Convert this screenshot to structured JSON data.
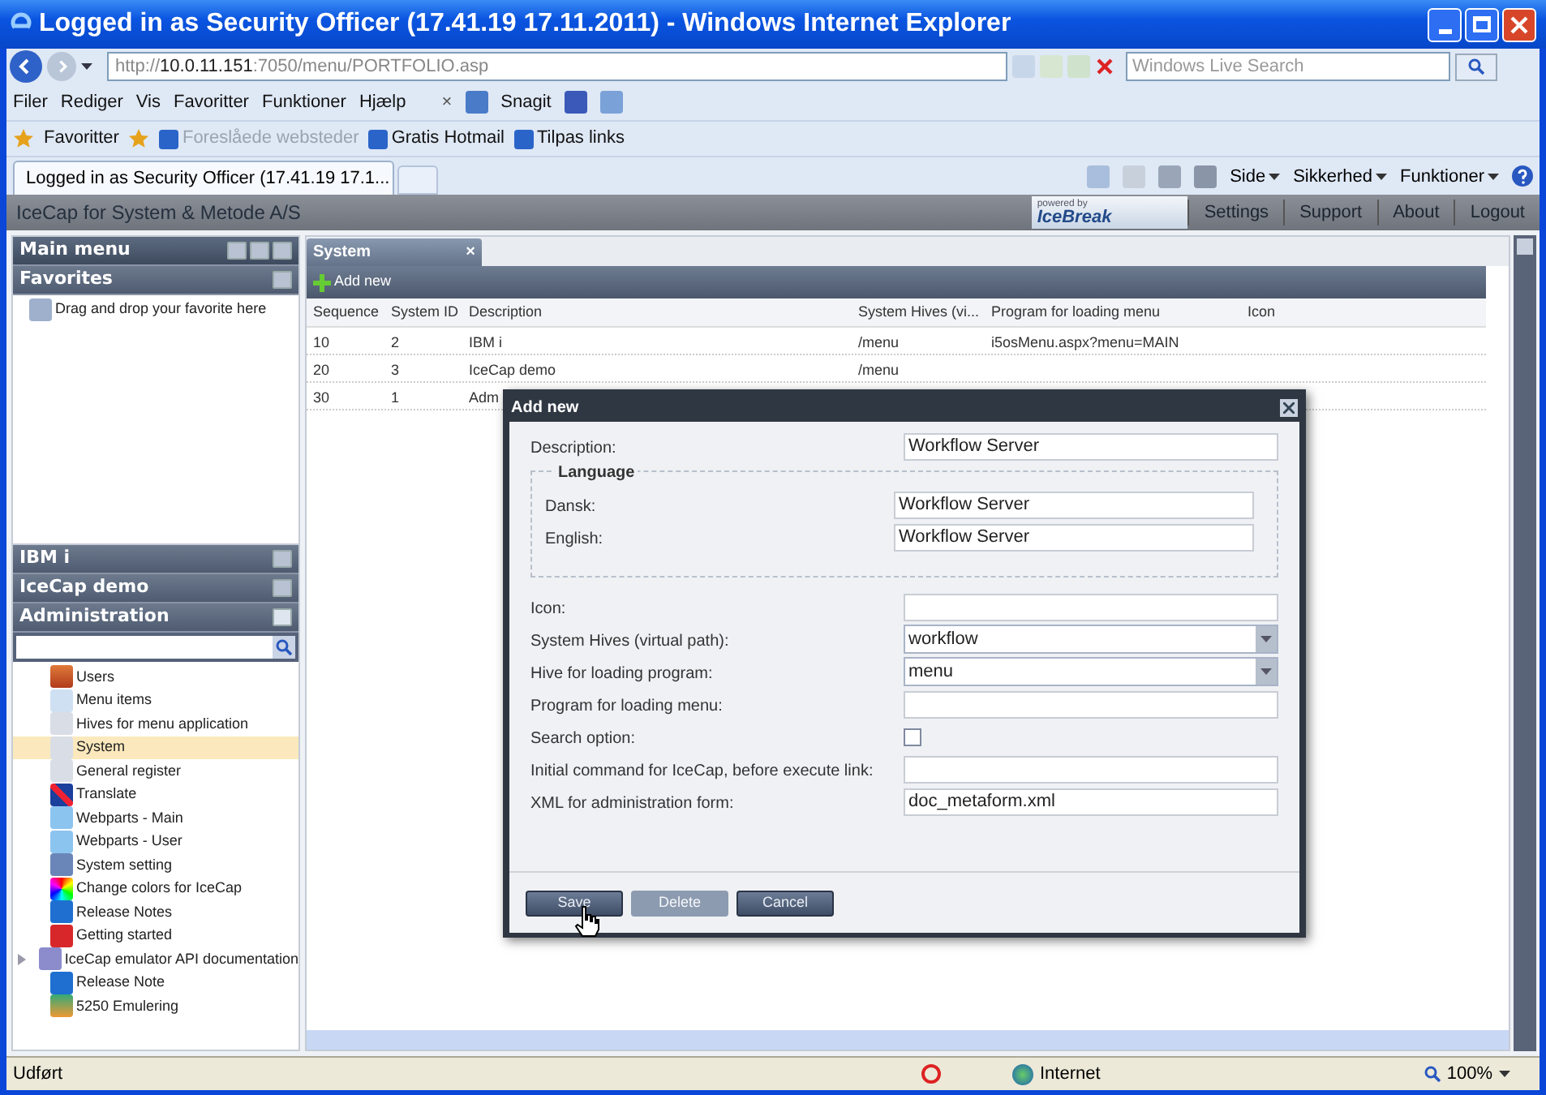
{
  "window": {
    "title": "Logged in as Security Officer (17.41.19 17.11.2011) - Windows Internet Explorer"
  },
  "address_bar": {
    "url_prefix": "http://",
    "url_host": "10.0.11.151",
    "url_rest": ":7050/menu/PORTFOLIO.asp",
    "search_placeholder": "Windows Live Search"
  },
  "menu_bar": [
    "Filer",
    "Rediger",
    "Vis",
    "Favoritter",
    "Funktioner",
    "Hjælp"
  ],
  "snagit": {
    "close": "×",
    "label": "Snagit"
  },
  "favorites_bar": {
    "favorites": "Favoritter",
    "links": [
      {
        "label": "Foreslåede websteder",
        "disabled": true
      },
      {
        "label": "Gratis Hotmail",
        "disabled": false
      },
      {
        "label": "Tilpas links",
        "disabled": false
      }
    ]
  },
  "tab": {
    "label": "Logged in as Security Officer (17.41.19 17.1..."
  },
  "command_bar": [
    "Side",
    "Sikkerhed",
    "Funktioner"
  ],
  "app_header": {
    "title": "IceCap for System & Metode A/S",
    "logo_small": "powered by",
    "logo": "IceBreak",
    "links": [
      "Settings",
      "Support",
      "About",
      "Logout"
    ]
  },
  "sidebar": {
    "main_menu": "Main menu",
    "favorites": "Favorites",
    "favorites_hint": "Drag and drop your favorite here",
    "sections": [
      {
        "label": "IBM i",
        "expanded": false
      },
      {
        "label": "IceCap demo",
        "expanded": false
      },
      {
        "label": "Administration",
        "expanded": true
      }
    ],
    "items": [
      {
        "label": "Users",
        "selected": false,
        "collapsed": false
      },
      {
        "label": "Menu items",
        "selected": false,
        "collapsed": false
      },
      {
        "label": "Hives for menu application",
        "selected": false,
        "collapsed": false
      },
      {
        "label": "System",
        "selected": true,
        "collapsed": false
      },
      {
        "label": "General register",
        "selected": false,
        "collapsed": false
      },
      {
        "label": "Translate",
        "selected": false,
        "collapsed": false
      },
      {
        "label": "Webparts - Main",
        "selected": false,
        "collapsed": false
      },
      {
        "label": "Webparts - User",
        "selected": false,
        "collapsed": false
      },
      {
        "label": "System setting",
        "selected": false,
        "collapsed": false
      },
      {
        "label": "Change colors for IceCap",
        "selected": false,
        "collapsed": false
      },
      {
        "label": "Release Notes",
        "selected": false,
        "collapsed": false
      },
      {
        "label": "Getting started",
        "selected": false,
        "collapsed": false
      },
      {
        "label": "IceCap emulator API documentation",
        "selected": false,
        "collapsed": true
      },
      {
        "label": "Release Note",
        "selected": false,
        "collapsed": false
      },
      {
        "label": "5250 Emulering",
        "selected": false,
        "collapsed": false
      }
    ]
  },
  "content_tab": {
    "label": "System",
    "close": "×"
  },
  "toolbar": {
    "add_new": "Add new"
  },
  "table": {
    "columns": [
      "Sequence",
      "System ID",
      "Description",
      "System Hives (vi...",
      "Program for loading menu",
      "Icon"
    ],
    "rows": [
      [
        "10",
        "2",
        "IBM i",
        "/menu",
        "i5osMenu.aspx?menu=MAIN",
        null
      ],
      [
        "20",
        "3",
        "IceCap demo",
        "/menu",
        null,
        null
      ],
      [
        "30",
        "1",
        "Adm",
        null,
        null,
        null
      ]
    ]
  },
  "dialog": {
    "title": "Add new",
    "fields": [
      {
        "kind": "text",
        "label": "Description:",
        "value": "Workflow Server"
      }
    ],
    "language_group": {
      "legend": "Language",
      "fields": [
        {
          "kind": "text",
          "label": "Dansk:",
          "value": "Workflow Server"
        },
        {
          "kind": "text",
          "label": "English:",
          "value": "Workflow Server"
        }
      ]
    },
    "fields2": [
      {
        "kind": "text",
        "label": "Icon:"
      },
      {
        "kind": "select",
        "label": "System Hives (virtual path):",
        "value": "workflow"
      },
      {
        "kind": "select",
        "label": "Hive for loading program:",
        "value": "menu"
      },
      {
        "kind": "text",
        "label": "Program for loading menu:"
      },
      {
        "kind": "checkbox",
        "label": "Search option:",
        "checked": false
      },
      {
        "kind": "text",
        "label": "Initial command for IceCap, before execute link:"
      },
      {
        "kind": "text",
        "label": "XML for administration form:",
        "value": "doc_metaform.xml"
      }
    ],
    "buttons": [
      {
        "label": "Save",
        "disabled": false
      },
      {
        "label": "Delete",
        "disabled": true
      },
      {
        "label": "Cancel",
        "disabled": false
      }
    ]
  },
  "status_bar": {
    "text": "Udført",
    "zone": "Internet",
    "zoom": "100%"
  }
}
